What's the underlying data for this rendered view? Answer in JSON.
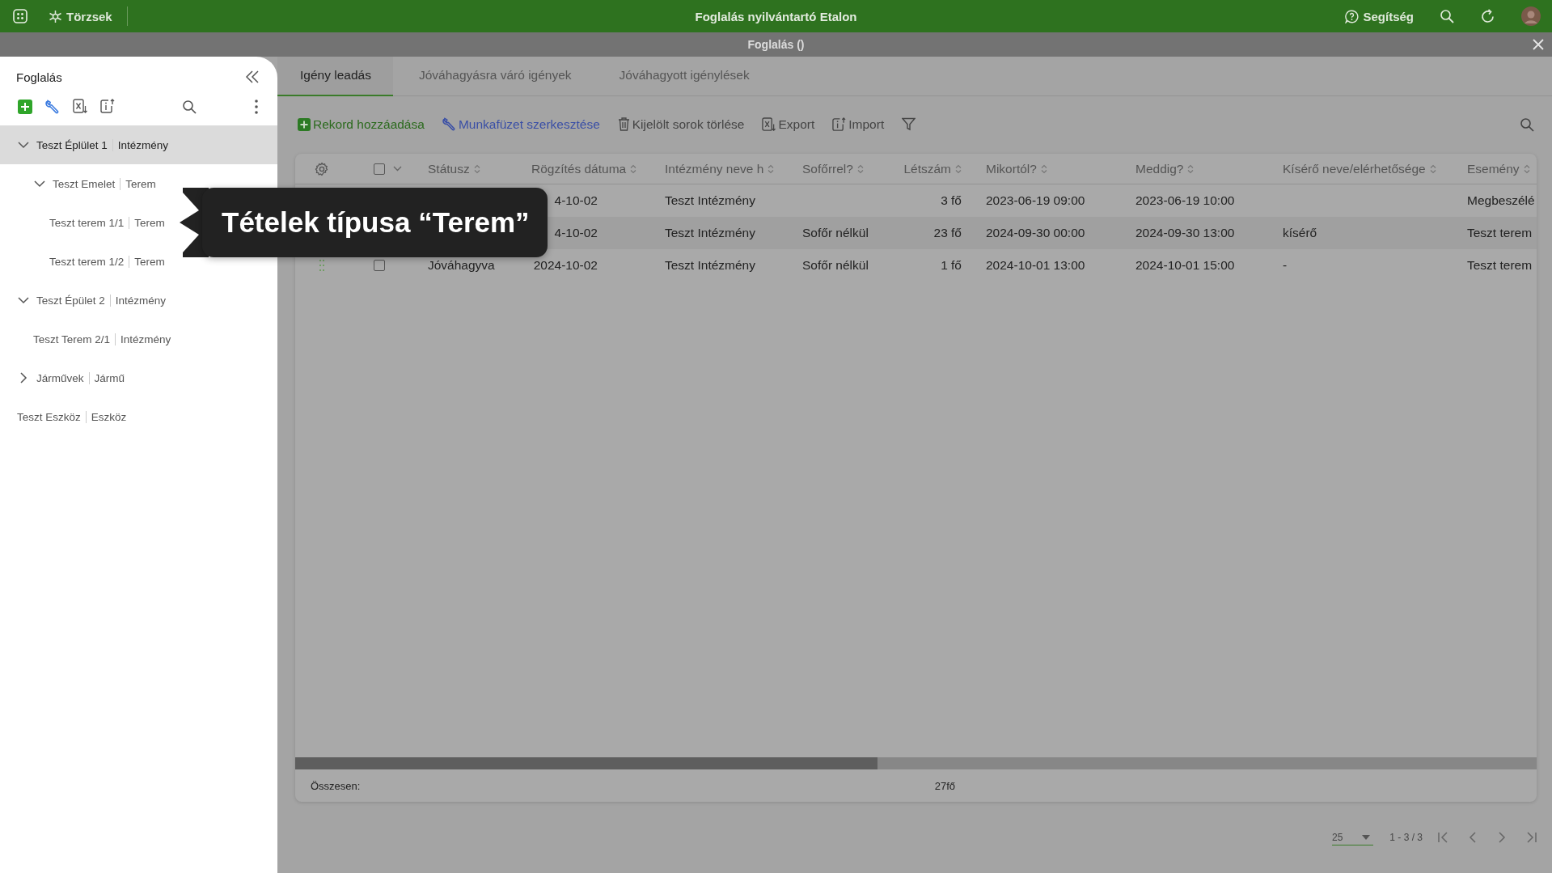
{
  "top_bar": {
    "module": "Törzsek",
    "title": "Foglalás nyilvántartó Etalon",
    "help": "Segítség"
  },
  "window": {
    "title": "Foglalás ()"
  },
  "sidebar": {
    "title": "Foglalás",
    "tree": [
      {
        "name": "Teszt Éplület 1",
        "type": "Intézmény",
        "expanded": true,
        "selected": true,
        "children": [
          {
            "name": "Teszt Emelet",
            "type": "Terem",
            "expanded": true,
            "selected": false,
            "children": [
              {
                "name": "Teszt terem 1/1",
                "type": "Terem",
                "selected": false
              },
              {
                "name": "Teszt terem 1/2",
                "type": "Terem",
                "selected": false
              }
            ]
          }
        ]
      },
      {
        "name": "Teszt Épület 2",
        "type": "Intézmény",
        "expanded": true,
        "selected": false,
        "children": [
          {
            "name": "Teszt Terem 2/1",
            "type": "Intézmény",
            "selected": false
          }
        ]
      },
      {
        "name": "Járművek",
        "type": "Jármű",
        "expanded": false,
        "selected": false
      },
      {
        "name": "Teszt Eszköz",
        "type": "Eszköz",
        "selected": false
      }
    ]
  },
  "tooltip": {
    "text": "Tételek típusa “Terem”"
  },
  "tabs": [
    {
      "label": "Igény leadás",
      "selected": true
    },
    {
      "label": "Jóváhagyásra váró igények",
      "selected": false
    },
    {
      "label": "Jóváhagyott igénylések",
      "selected": false
    }
  ],
  "toolbar": [
    {
      "label": "Rekord hozzáadása",
      "kind": "add"
    },
    {
      "label": "Munkafüzet szerkesztése",
      "kind": "edit"
    },
    {
      "label": "Kijelölt sorok törlése",
      "kind": "delete"
    },
    {
      "label": "Export",
      "kind": "export"
    },
    {
      "label": "Import",
      "kind": "import"
    }
  ],
  "table": {
    "select_all": {
      "checked": false
    },
    "columns": [
      "Státusz",
      "Rögzítés dátuma",
      "Intézmény neve h",
      "Sofőrrel?",
      "Létszám",
      "Mikortól?",
      "Meddig?",
      "Kísérő neve/elérhetősége",
      "Esemény"
    ],
    "rows": [
      {
        "date": "4-10-02",
        "institution": "Teszt Intézmény",
        "driver": "",
        "count": "3 fő",
        "from": "2023-06-19 09:00",
        "to": "2023-06-19 10:00",
        "escort": "",
        "event": "Megbeszélé"
      },
      {
        "date": "4-10-02",
        "institution": "Teszt Intézmény",
        "driver": "Sofőr nélkül",
        "count": "23 fő",
        "from": "2024-09-30 00:00",
        "to": "2024-09-30 13:00",
        "escort": "kísérő",
        "event": "Teszt terem"
      },
      {
        "checked": false,
        "status": "Jóváhagyva",
        "date": "2024-10-02",
        "institution": "Teszt Intézmény",
        "driver": "Sofőr nélkül",
        "count": "1 fő",
        "from": "2024-10-01 13:00",
        "to": "2024-10-01 15:00",
        "escort": "-",
        "event": "Teszt terem"
      }
    ],
    "footer_label": "Összesen:",
    "footer_total": "27fő"
  },
  "pagination": {
    "page_size": "25",
    "range": "1 - 3 / 3"
  }
}
